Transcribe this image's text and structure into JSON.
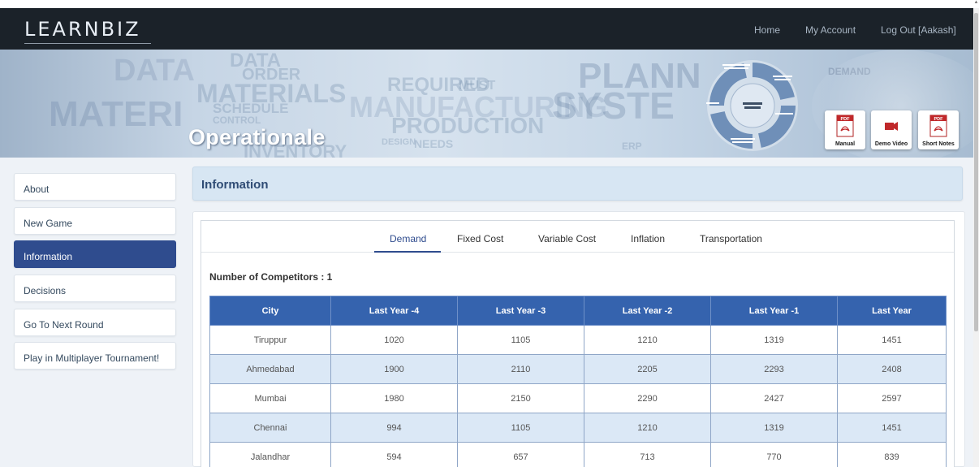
{
  "navbar": {
    "logo": "LEARNBIZ",
    "links": [
      {
        "label": "Home"
      },
      {
        "label": "My Account"
      },
      {
        "label": "Log Out [Aakash]"
      }
    ]
  },
  "banner": {
    "title": "Operationale",
    "buttons": [
      {
        "label": "Manual",
        "icon": "pdf-icon"
      },
      {
        "label": "Demo Video",
        "icon": "video-icon"
      },
      {
        "label": "Short Notes",
        "icon": "pdf-icon"
      }
    ]
  },
  "sidebar": {
    "items": [
      {
        "label": "About"
      },
      {
        "label": "New Game"
      },
      {
        "label": "Information"
      },
      {
        "label": "Decisions"
      },
      {
        "label": "Go To Next Round"
      },
      {
        "label": "Play in Multiplayer Tournament!"
      }
    ],
    "active_index": 2
  },
  "main": {
    "header": "Information",
    "tabs": [
      {
        "label": "Demand"
      },
      {
        "label": "Fixed Cost"
      },
      {
        "label": "Variable Cost"
      },
      {
        "label": "Inflation"
      },
      {
        "label": "Transportation"
      }
    ],
    "active_tab": 0,
    "competitors_label": "Number of Competitors : 1",
    "table": {
      "columns": [
        "City",
        "Last Year -4",
        "Last Year -3",
        "Last Year -2",
        "Last Year -1",
        "Last Year"
      ],
      "rows": [
        [
          "Tiruppur",
          "1020",
          "1105",
          "1210",
          "1319",
          "1451"
        ],
        [
          "Ahmedabad",
          "1900",
          "2110",
          "2205",
          "2293",
          "2408"
        ],
        [
          "Mumbai",
          "1980",
          "2150",
          "2290",
          "2427",
          "2597"
        ],
        [
          "Chennai",
          "994",
          "1105",
          "1210",
          "1319",
          "1451"
        ],
        [
          "Jalandhar",
          "594",
          "657",
          "713",
          "770",
          "839"
        ]
      ]
    }
  },
  "colors": {
    "navbar": "#1b2229",
    "accent": "#2f4c8e",
    "table_header": "#3563ae",
    "row_alt": "#dbe8f6"
  }
}
